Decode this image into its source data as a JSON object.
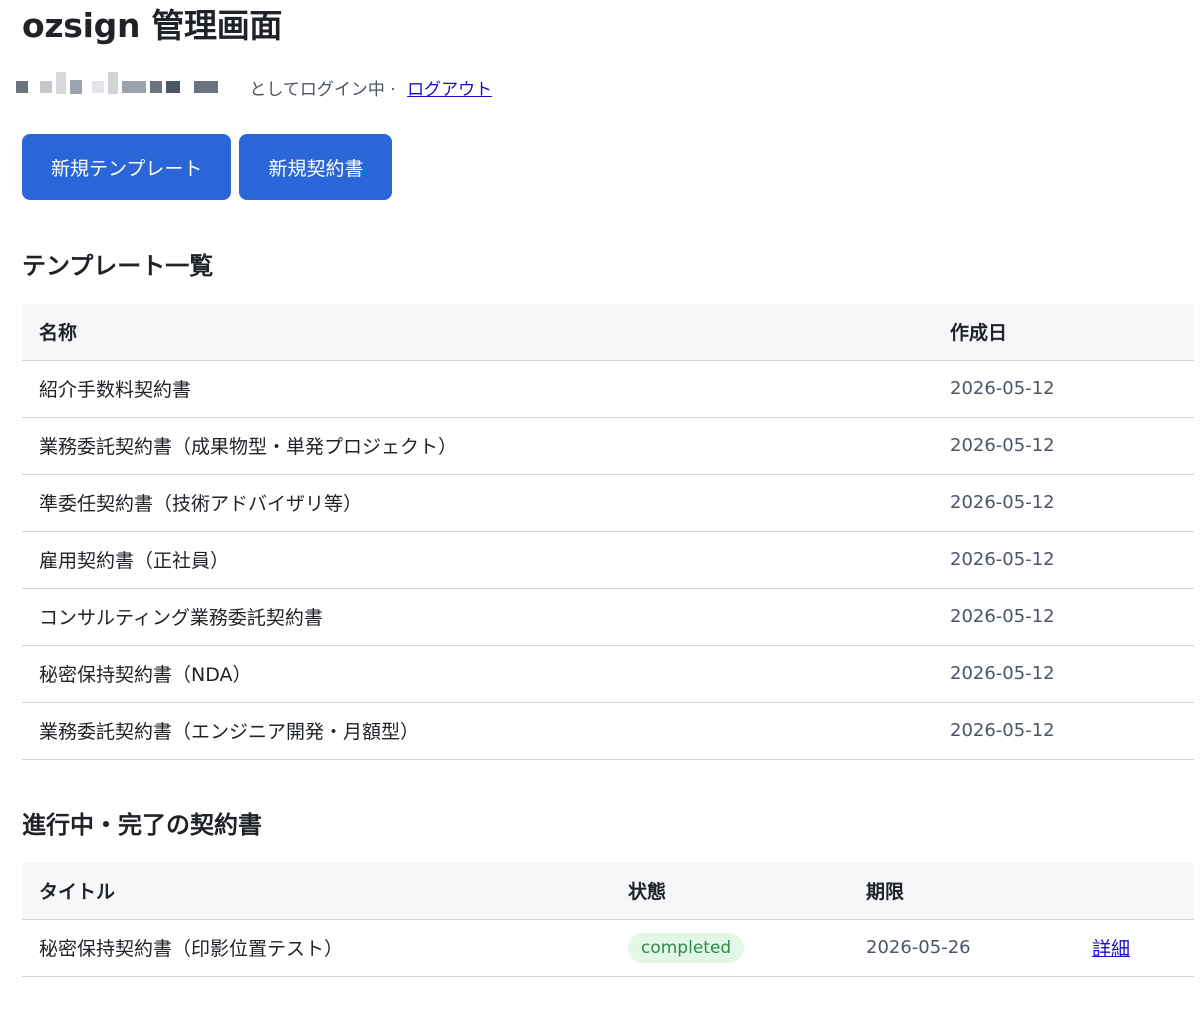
{
  "header": {
    "title": "ozsign 管理画面",
    "login_suffix": " としてログイン中 · ",
    "logout_label": "ログアウト"
  },
  "actions": {
    "new_template_label": "新規テンプレート",
    "new_contract_label": "新規契約書"
  },
  "templates": {
    "section_title": "テンプレート一覧",
    "columns": {
      "name": "名称",
      "created": "作成日"
    },
    "rows": [
      {
        "name": "紹介手数料契約書",
        "created": "2026-05-12"
      },
      {
        "name": "業務委託契約書（成果物型・単発プロジェクト）",
        "created": "2026-05-12"
      },
      {
        "name": "準委任契約書（技術アドバイザリ等）",
        "created": "2026-05-12"
      },
      {
        "name": "雇用契約書（正社員）",
        "created": "2026-05-12"
      },
      {
        "name": "コンサルティング業務委託契約書",
        "created": "2026-05-12"
      },
      {
        "name": "秘密保持契約書（NDA）",
        "created": "2026-05-12"
      },
      {
        "name": "業務委託契約書（エンジニア開発・月額型）",
        "created": "2026-05-12"
      }
    ]
  },
  "contracts": {
    "section_title": "進行中・完了の契約書",
    "columns": {
      "title": "タイトル",
      "status": "状態",
      "deadline": "期限",
      "action": ""
    },
    "rows": [
      {
        "title": "秘密保持契約書（印影位置テスト）",
        "status": "completed",
        "deadline": "2026-05-26",
        "detail_label": "詳細"
      }
    ]
  },
  "colors": {
    "primary_button": "#2b66d9",
    "link": "#1a0dcc",
    "badge_bg": "#e2f7e6",
    "badge_text": "#2f8a45",
    "table_header_bg": "#f6f7f8"
  }
}
